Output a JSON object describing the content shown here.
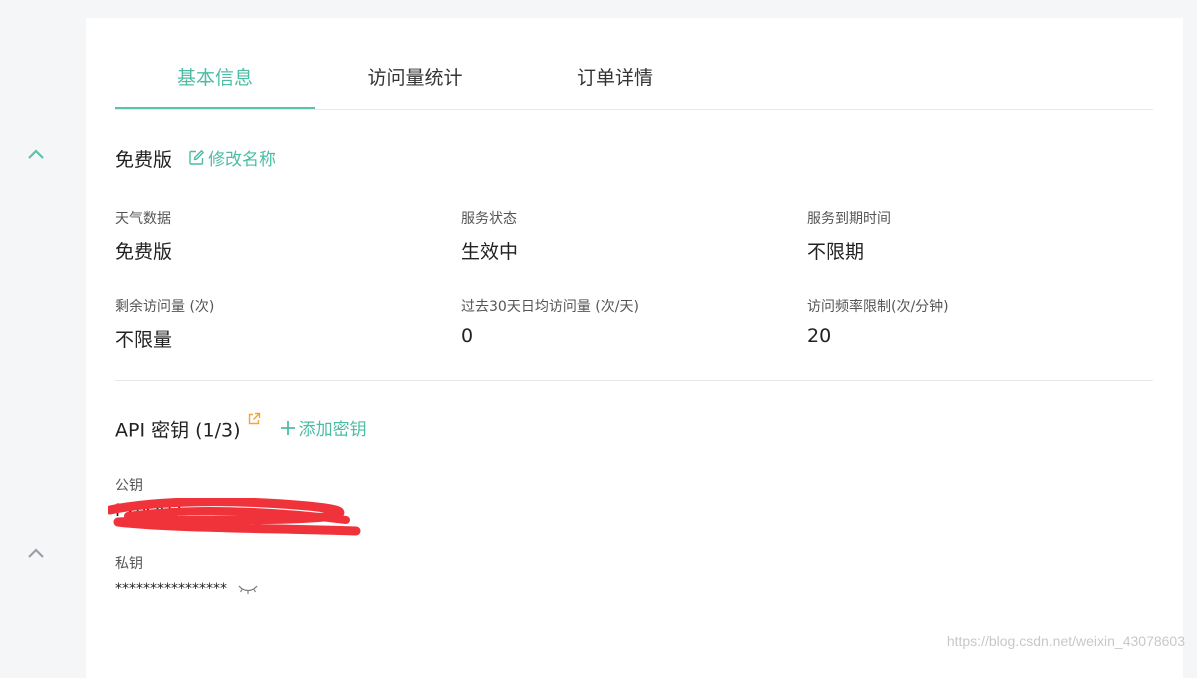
{
  "tabs": [
    {
      "label": "基本信息",
      "active": true
    },
    {
      "label": "访问量统计",
      "active": false
    },
    {
      "label": "订单详情",
      "active": false
    }
  ],
  "plan": {
    "name": "免费版",
    "edit_label": "修改名称"
  },
  "info": [
    {
      "label": "天气数据",
      "value": "免费版"
    },
    {
      "label": "服务状态",
      "value": "生效中"
    },
    {
      "label": "服务到期时间",
      "value": "不限期"
    },
    {
      "label": "剩余访问量 (次)",
      "value": "不限量"
    },
    {
      "label": "过去30天日均访问量 (次/天)",
      "value": "0"
    },
    {
      "label": "访问频率限制(次/分钟)",
      "value": "20"
    }
  ],
  "api": {
    "title": "API 密钥 (1/3)",
    "add_label": "添加密钥",
    "public_key_label": "公钥",
    "public_key_value": "PxbQU7",
    "private_key_label": "私钥",
    "private_key_value": "****************"
  },
  "watermark": "https://blog.csdn.net/weixin_43078603",
  "colors": {
    "accent": "#4dbca5",
    "external_link_icon": "#f0a43c",
    "redaction": "#f0333a"
  },
  "icons": [
    "chevron-up-icon",
    "edit-icon",
    "external-link-icon",
    "plus-icon",
    "eye-closed-icon"
  ]
}
